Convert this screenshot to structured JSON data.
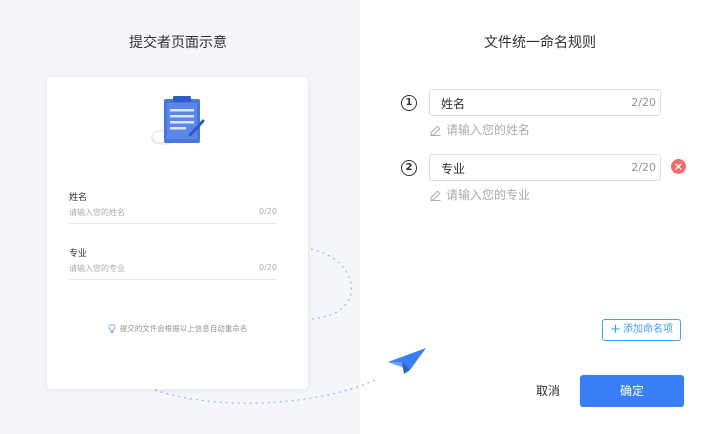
{
  "left": {
    "title": "提交者页面示意",
    "preview": {
      "field1_label": "姓名",
      "field1_placeholder": "请输入您的姓名",
      "field1_count": "0/20",
      "field2_label": "专业",
      "field2_placeholder": "请输入您的专业",
      "field2_count": "0/20",
      "hint": "提交的文件会根据以上信息自动重命名"
    }
  },
  "right": {
    "title": "文件统一命名规则",
    "rules": [
      {
        "number": "1",
        "value": "姓名",
        "count": "2/20",
        "hint": "请输入您的姓名"
      },
      {
        "number": "2",
        "value": "专业",
        "count": "2/20",
        "hint": "请输入您的专业"
      }
    ],
    "add_label": "添加命名项",
    "cancel_label": "取消",
    "confirm_label": "确定"
  },
  "colors": {
    "accent": "#3a7ef7",
    "link": "#409eff",
    "danger": "#f56c6c",
    "left_bg": "#f3f5f9"
  },
  "icons": [
    "clipboard-illustration",
    "bulb-icon",
    "pencil-icon",
    "close-circle-icon",
    "plus-icon",
    "paper-plane-icon"
  ]
}
